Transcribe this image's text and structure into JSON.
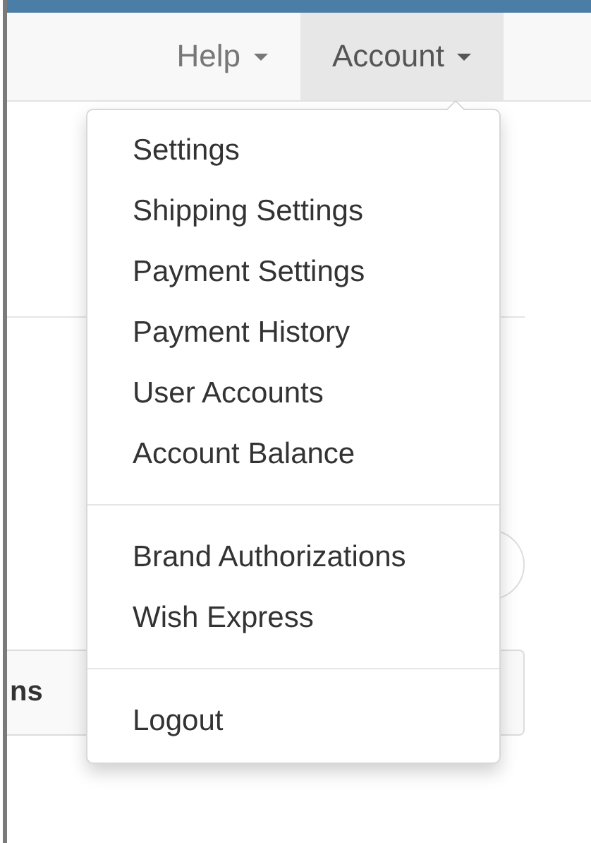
{
  "nav": [
    {
      "label": "Help",
      "selected": false
    },
    {
      "label": "Account",
      "selected": true
    }
  ],
  "account_menu": {
    "groups": [
      [
        "Settings",
        "Shipping Settings",
        "Payment Settings",
        "Payment History",
        "User Accounts",
        "Account Balance"
      ],
      [
        "Brand Authorizations",
        "Wish Express"
      ],
      [
        "Logout"
      ]
    ]
  },
  "table": {
    "header_fragment": "ns"
  }
}
